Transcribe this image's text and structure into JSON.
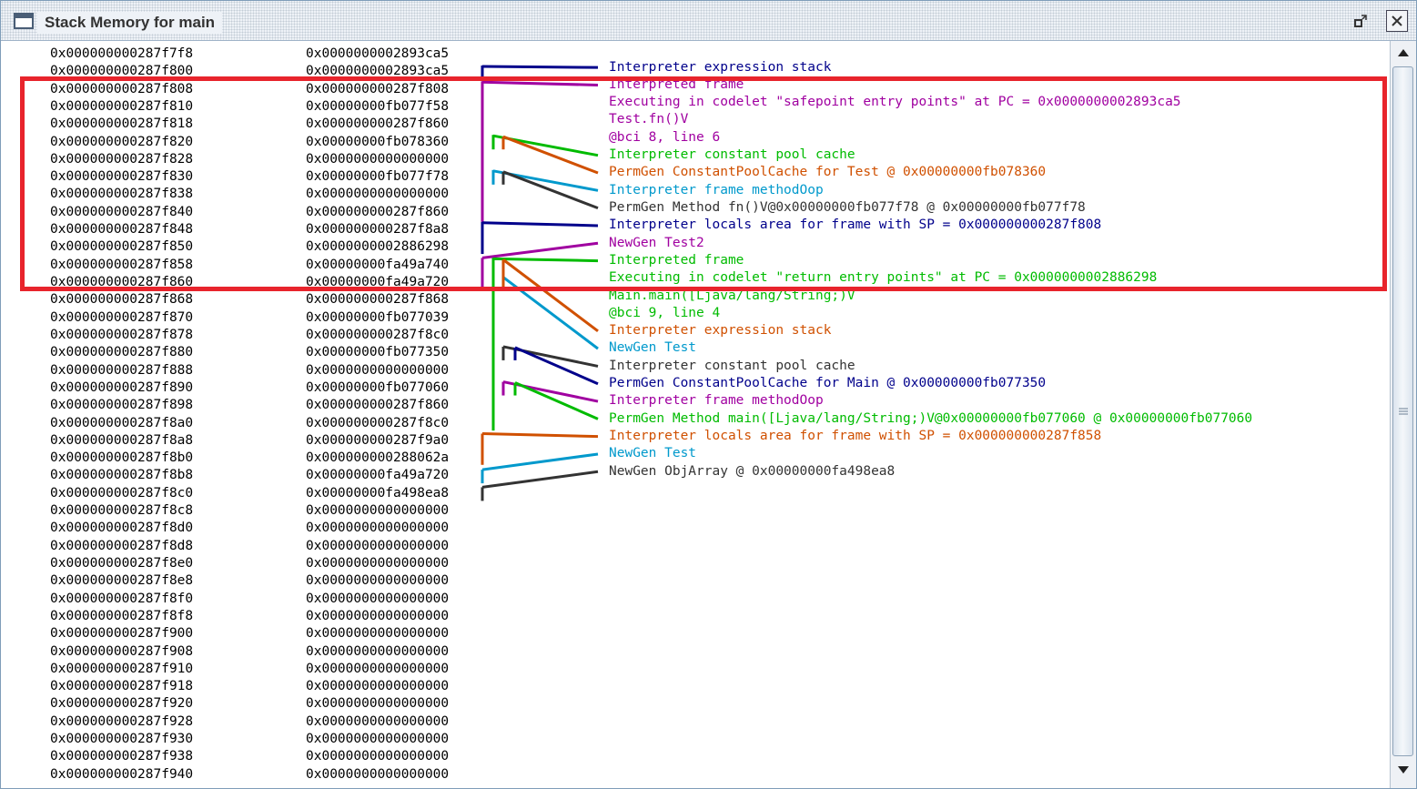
{
  "window": {
    "title": "Stack Memory for main",
    "icons": {
      "window": "window-icon",
      "restore": "restore-icon",
      "close": "close-icon",
      "scroll_up": "arrow-up-icon",
      "scroll_down": "arrow-down-icon",
      "grip": "grip-icon"
    }
  },
  "rows": [
    {
      "addr": "0x000000000287f7f8",
      "value": "0x0000000002893ca5"
    },
    {
      "addr": "0x000000000287f800",
      "value": "0x0000000002893ca5"
    },
    {
      "addr": "0x000000000287f808",
      "value": "0x000000000287f808"
    },
    {
      "addr": "0x000000000287f810",
      "value": "0x00000000fb077f58"
    },
    {
      "addr": "0x000000000287f818",
      "value": "0x000000000287f860"
    },
    {
      "addr": "0x000000000287f820",
      "value": "0x00000000fb078360"
    },
    {
      "addr": "0x000000000287f828",
      "value": "0x0000000000000000"
    },
    {
      "addr": "0x000000000287f830",
      "value": "0x00000000fb077f78"
    },
    {
      "addr": "0x000000000287f838",
      "value": "0x0000000000000000"
    },
    {
      "addr": "0x000000000287f840",
      "value": "0x000000000287f860"
    },
    {
      "addr": "0x000000000287f848",
      "value": "0x000000000287f8a8"
    },
    {
      "addr": "0x000000000287f850",
      "value": "0x0000000002886298"
    },
    {
      "addr": "0x000000000287f858",
      "value": "0x00000000fa49a740"
    },
    {
      "addr": "0x000000000287f860",
      "value": "0x00000000fa49a720"
    },
    {
      "addr": "0x000000000287f868",
      "value": "0x000000000287f868"
    },
    {
      "addr": "0x000000000287f870",
      "value": "0x00000000fb077039"
    },
    {
      "addr": "0x000000000287f878",
      "value": "0x000000000287f8c0"
    },
    {
      "addr": "0x000000000287f880",
      "value": "0x00000000fb077350"
    },
    {
      "addr": "0x000000000287f888",
      "value": "0x0000000000000000"
    },
    {
      "addr": "0x000000000287f890",
      "value": "0x00000000fb077060"
    },
    {
      "addr": "0x000000000287f898",
      "value": "0x000000000287f860"
    },
    {
      "addr": "0x000000000287f8a0",
      "value": "0x000000000287f8c0"
    },
    {
      "addr": "0x000000000287f8a8",
      "value": "0x000000000287f9a0"
    },
    {
      "addr": "0x000000000287f8b0",
      "value": "0x000000000288062a"
    },
    {
      "addr": "0x000000000287f8b8",
      "value": "0x00000000fa49a720"
    },
    {
      "addr": "0x000000000287f8c0",
      "value": "0x00000000fa498ea8"
    },
    {
      "addr": "0x000000000287f8c8",
      "value": "0x0000000000000000"
    },
    {
      "addr": "0x000000000287f8d0",
      "value": "0x0000000000000000"
    },
    {
      "addr": "0x000000000287f8d8",
      "value": "0x0000000000000000"
    },
    {
      "addr": "0x000000000287f8e0",
      "value": "0x0000000000000000"
    },
    {
      "addr": "0x000000000287f8e8",
      "value": "0x0000000000000000"
    },
    {
      "addr": "0x000000000287f8f0",
      "value": "0x0000000000000000"
    },
    {
      "addr": "0x000000000287f8f8",
      "value": "0x0000000000000000"
    },
    {
      "addr": "0x000000000287f900",
      "value": "0x0000000000000000"
    },
    {
      "addr": "0x000000000287f908",
      "value": "0x0000000000000000"
    },
    {
      "addr": "0x000000000287f910",
      "value": "0x0000000000000000"
    },
    {
      "addr": "0x000000000287f918",
      "value": "0x0000000000000000"
    },
    {
      "addr": "0x000000000287f920",
      "value": "0x0000000000000000"
    },
    {
      "addr": "0x000000000287f928",
      "value": "0x0000000000000000"
    },
    {
      "addr": "0x000000000287f930",
      "value": "0x0000000000000000"
    },
    {
      "addr": "0x000000000287f938",
      "value": "0x0000000000000000"
    },
    {
      "addr": "0x000000000287f940",
      "value": "0x0000000000000000"
    }
  ],
  "annotations": [
    {
      "text": "Interpreter expression stack",
      "color": "#00008b"
    },
    {
      "text": "Interpreted frame",
      "color": "#a000a0"
    },
    {
      "text": "Executing in codelet \"safepoint entry points\" at PC = 0x0000000002893ca5",
      "color": "#a000a0"
    },
    {
      "text": "Test.fn()V",
      "color": "#a000a0"
    },
    {
      "text": "@bci 8, line 6",
      "color": "#a000a0"
    },
    {
      "text": "Interpreter constant pool cache",
      "color": "#00bb00"
    },
    {
      "text": "PermGen ConstantPoolCache for Test @ 0x00000000fb078360",
      "color": "#d05000"
    },
    {
      "text": "Interpreter frame methodOop",
      "color": "#0099cc"
    },
    {
      "text": "PermGen Method fn()V@0x00000000fb077f78 @ 0x00000000fb077f78",
      "color": "#333333"
    },
    {
      "text": "Interpreter locals area for frame with SP = 0x000000000287f808",
      "color": "#00008b"
    },
    {
      "text": "NewGen Test2",
      "color": "#a000a0"
    },
    {
      "text": "Interpreted frame",
      "color": "#00bb00"
    },
    {
      "text": "Executing in codelet \"return entry points\" at PC = 0x0000000002886298",
      "color": "#00bb00"
    },
    {
      "text": "Main.main([Ljava/lang/String;)V",
      "color": "#00bb00"
    },
    {
      "text": "@bci 9, line 4",
      "color": "#00bb00"
    },
    {
      "text": "Interpreter expression stack",
      "color": "#d05000"
    },
    {
      "text": "NewGen Test",
      "color": "#0099cc"
    },
    {
      "text": "Interpreter constant pool cache",
      "color": "#333333"
    },
    {
      "text": "PermGen ConstantPoolCache for Main @ 0x00000000fb077350",
      "color": "#00008b"
    },
    {
      "text": "Interpreter frame methodOop",
      "color": "#a000a0"
    },
    {
      "text": "PermGen Method main([Ljava/lang/String;)V@0x00000000fb077060 @ 0x00000000fb077060",
      "color": "#00bb00"
    },
    {
      "text": "Interpreter locals area for frame with SP = 0x000000000287f858",
      "color": "#d05000"
    },
    {
      "text": "NewGen Test",
      "color": "#0099cc"
    },
    {
      "text": "NewGen ObjArray @ 0x00000000fa498ea8",
      "color": "#333333"
    }
  ]
}
